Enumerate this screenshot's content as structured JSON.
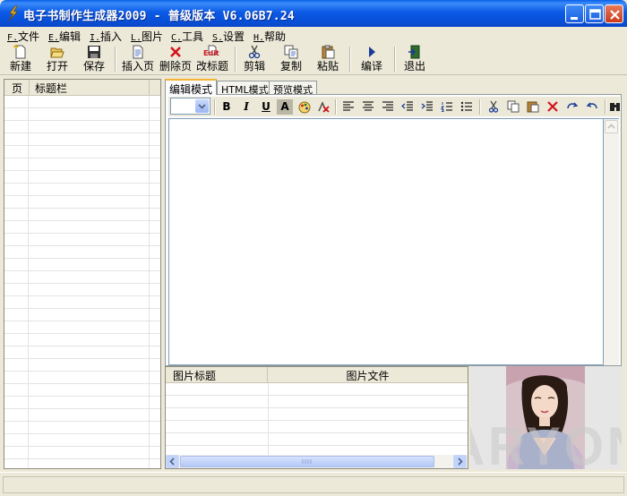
{
  "window": {
    "title": "电子书制作生成器2009 - 普级版本 V6.06B7.24",
    "buttons": [
      "minimize-icon",
      "maximize-icon",
      "close-icon"
    ]
  },
  "menu": [
    {
      "key": "F.",
      "label": "文件"
    },
    {
      "key": "E.",
      "label": "编辑"
    },
    {
      "key": "I.",
      "label": "插入"
    },
    {
      "key": "L.",
      "label": "图片"
    },
    {
      "key": "C.",
      "label": "工具"
    },
    {
      "key": "S.",
      "label": "设置"
    },
    {
      "key": "H.",
      "label": "帮助"
    }
  ],
  "toolbar": {
    "new": "新建",
    "open": "打开",
    "save": "保存",
    "insert_page": "插入页",
    "delete_page": "删除页",
    "rename_title": "改标题",
    "edit_badge": "Edit",
    "cut": "剪辑",
    "copy": "复制",
    "paste": "粘贴",
    "compile": "编译",
    "exit": "退出"
  },
  "page_list": {
    "col_page": "页",
    "col_title": "标题栏"
  },
  "tabs": [
    "编辑模式",
    "HTML模式",
    "预览模式"
  ],
  "format_bar": {
    "bold": "B",
    "italic": "I",
    "underline": "U",
    "font_color": "A"
  },
  "pictures": {
    "col_title": "图片标题",
    "col_file": "图片文件"
  },
  "preview": {
    "watermark": "ARYON"
  },
  "colors": {
    "titlebar": "#0b5ae6",
    "chrome": "#ece9d8",
    "active_tab": "#f6b333"
  }
}
